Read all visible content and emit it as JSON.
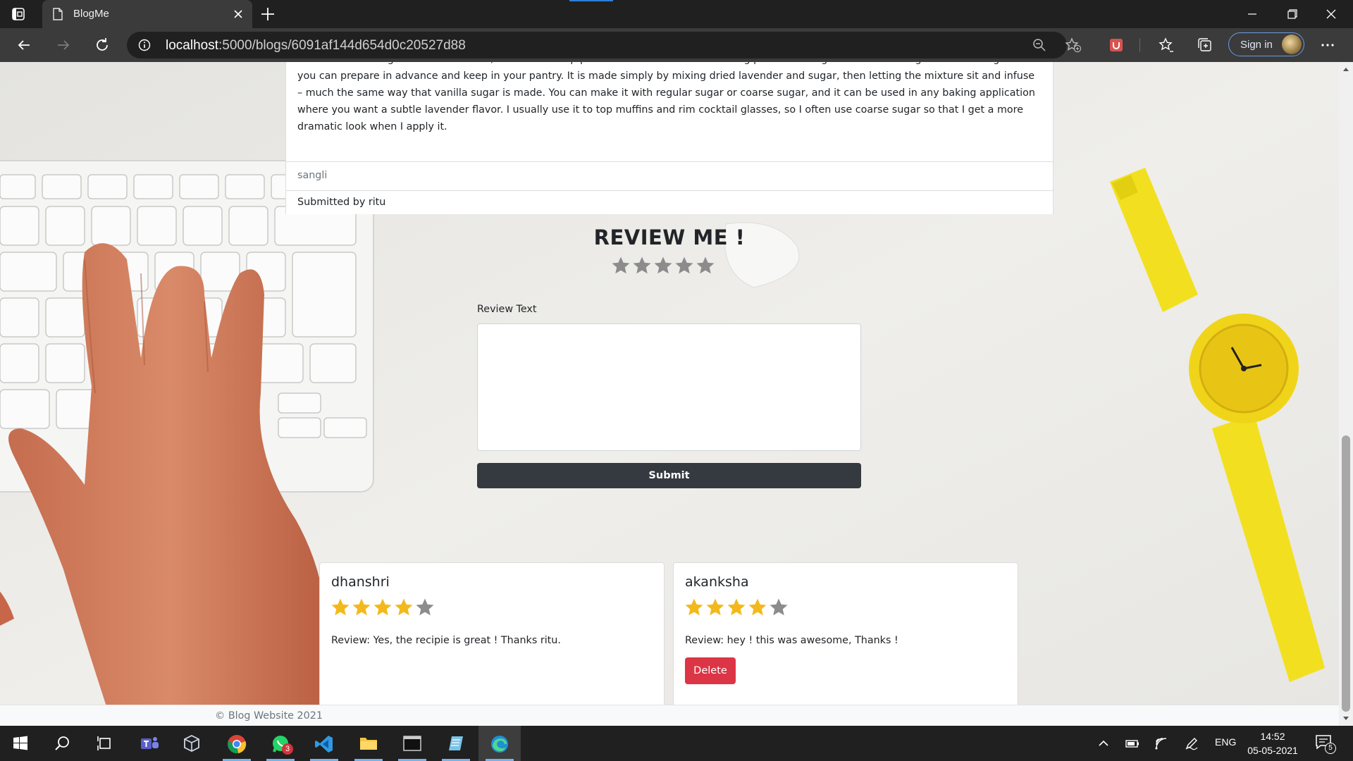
{
  "browser": {
    "tab_title": "BlogMe",
    "url_host": "localhost",
    "url_rest": ":5000/blogs/6091af144d654d0c20527d88",
    "signin_label": "Sign in"
  },
  "blog": {
    "text": "flour before adding them to the batter, as that will help prevent the berries from bleeding prior to baking. The lavender sugar is something that you can prepare in advance and keep in your pantry. It is made simply by mixing dried lavender and sugar, then letting the mixture sit and infuse – much the same way that vanilla sugar is made. You can make it with regular sugar or coarse sugar, and it can be used in any baking application where you want a subtle lavender flavor. I usually use it to top muffins and rim cocktail glasses, so I often use coarse sugar so that I get a more dramatic look when I apply it.",
    "location": "sangli",
    "submitted_by": "Submitted by ritu"
  },
  "review_form": {
    "title": "REVIEW ME !",
    "rating_value": 0,
    "rating_max": 5,
    "label": "Review Text",
    "textarea_value": "",
    "submit_label": "Submit"
  },
  "reviews": [
    {
      "author": "dhanshri",
      "rating": 4,
      "text": "Review: Yes, the recipie is great ! Thanks ritu.",
      "has_delete": false
    },
    {
      "author": "akanksha",
      "rating": 4,
      "text": "Review: hey ! this was awesome, Thanks !",
      "has_delete": true,
      "delete_label": "Delete"
    }
  ],
  "footer": {
    "copyright": "© Blog Website 2021"
  },
  "colors": {
    "star_filled": "#f3b91c",
    "star_empty": "#8c8c8c",
    "submit_bg": "#343a40",
    "delete_bg": "#dc3545"
  },
  "taskbar": {
    "apps": [
      "start-icon",
      "search-icon",
      "task-view-icon",
      "teams-icon",
      "virtualbox-icon",
      "chrome-icon",
      "whatsapp-icon",
      "vscode-icon",
      "file-explorer-icon",
      "terminal-icon",
      "notepad-icon",
      "edge-icon"
    ],
    "whatsapp_badge": "3",
    "language": "ENG",
    "time": "14:52",
    "date": "05-05-2021",
    "notification_count": "5"
  }
}
